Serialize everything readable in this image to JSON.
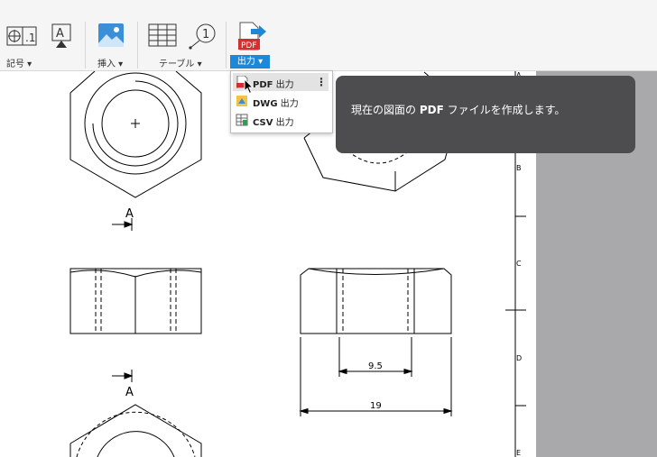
{
  "ribbon": {
    "groups": {
      "symbol": "記号 ▾",
      "insert": "挿入 ▾",
      "table": "テーブル ▾",
      "output": "出力 ▾"
    },
    "balloon_number": "1",
    "pdf_icon_text": "PDF"
  },
  "output_menu": {
    "items": [
      {
        "format": "PDF",
        "suffix": "出力"
      },
      {
        "format": "DWG",
        "suffix": "出力"
      },
      {
        "format": "CSV",
        "suffix": "出力"
      }
    ],
    "more": "⋮"
  },
  "tooltip": {
    "prefix": "現在の図面の ",
    "bold": "PDF",
    "suffix": " ファイルを作成します。"
  },
  "drawing": {
    "section_label_top": "A",
    "section_label_bottom": "A",
    "dim_inner": "9.5",
    "dim_outer": "19",
    "zones": [
      "A",
      "B",
      "C",
      "D",
      "E"
    ]
  }
}
